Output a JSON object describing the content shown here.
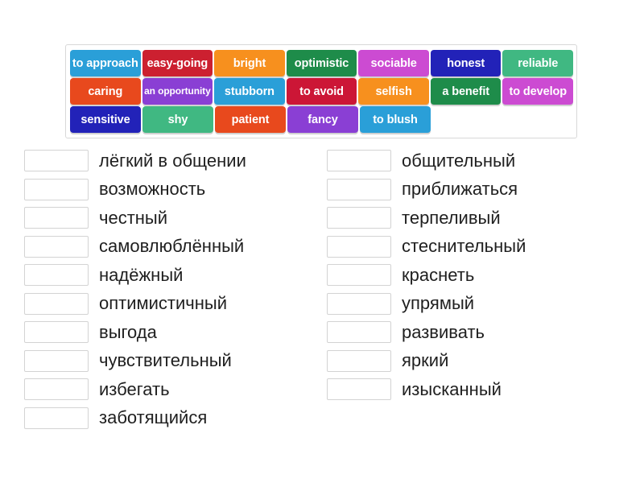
{
  "word_bank": {
    "rows": [
      [
        {
          "label": "to approach",
          "color": "#2a9fd8",
          "multiline": false
        },
        {
          "label": "easy-going",
          "color": "#cc2030",
          "multiline": false
        },
        {
          "label": "bright",
          "color": "#f7901e",
          "multiline": false
        },
        {
          "label": "optimistic",
          "color": "#1e8c4a",
          "multiline": false
        },
        {
          "label": "sociable",
          "color": "#cc4bd2",
          "multiline": false
        },
        {
          "label": "honest",
          "color": "#2222b8",
          "multiline": false
        },
        {
          "label": "reliable",
          "color": "#40b882",
          "multiline": false
        }
      ],
      [
        {
          "label": "caring",
          "color": "#e8491d",
          "multiline": false
        },
        {
          "label": "an opportunity",
          "color": "#8a3fd4",
          "multiline": true
        },
        {
          "label": "stubborn",
          "color": "#2a9fd8",
          "multiline": false
        },
        {
          "label": "to avoid",
          "color": "#cc1636",
          "multiline": false
        },
        {
          "label": "selfish",
          "color": "#f7901e",
          "multiline": false
        },
        {
          "label": "a benefit",
          "color": "#1e8c4a",
          "multiline": false
        },
        {
          "label": "to develop",
          "color": "#cc4bd2",
          "multiline": false
        }
      ],
      [
        {
          "label": "sensitive",
          "color": "#2222b8",
          "multiline": false
        },
        {
          "label": "shy",
          "color": "#40b882",
          "multiline": false
        },
        {
          "label": "patient",
          "color": "#e8491d",
          "multiline": false
        },
        {
          "label": "fancy",
          "color": "#8a3fd4",
          "multiline": false
        },
        {
          "label": "to blush",
          "color": "#2a9fd8",
          "multiline": false
        }
      ]
    ]
  },
  "lists": {
    "left": [
      {
        "box_value": "",
        "word": "лёгкий в общении"
      },
      {
        "box_value": "",
        "word": "возможность"
      },
      {
        "box_value": "",
        "word": "честный"
      },
      {
        "box_value": "",
        "word": "самовлюблённый"
      },
      {
        "box_value": "",
        "word": "надёжный"
      },
      {
        "box_value": "",
        "word": "оптимистичный"
      },
      {
        "box_value": "",
        "word": "выгода"
      },
      {
        "box_value": "",
        "word": "чувствительный"
      },
      {
        "box_value": "",
        "word": "избегать"
      },
      {
        "box_value": "",
        "word": "заботящийся"
      }
    ],
    "right": [
      {
        "box_value": "",
        "word": "общительный"
      },
      {
        "box_value": "",
        "word": "приближаться"
      },
      {
        "box_value": "",
        "word": "терпеливый"
      },
      {
        "box_value": "",
        "word": "стеснительный"
      },
      {
        "box_value": "",
        "word": "краснеть"
      },
      {
        "box_value": "",
        "word": "упрямый"
      },
      {
        "box_value": "",
        "word": "развивать"
      },
      {
        "box_value": "",
        "word": "яркий"
      },
      {
        "box_value": "",
        "word": "изысканный"
      }
    ]
  },
  "colors": {
    "page_background": "#ffffff",
    "bank_border": "#d8d8d8",
    "box_border": "#d3d3d3",
    "word_text": "#1f1f1f",
    "tile_text": "#ffffff"
  }
}
